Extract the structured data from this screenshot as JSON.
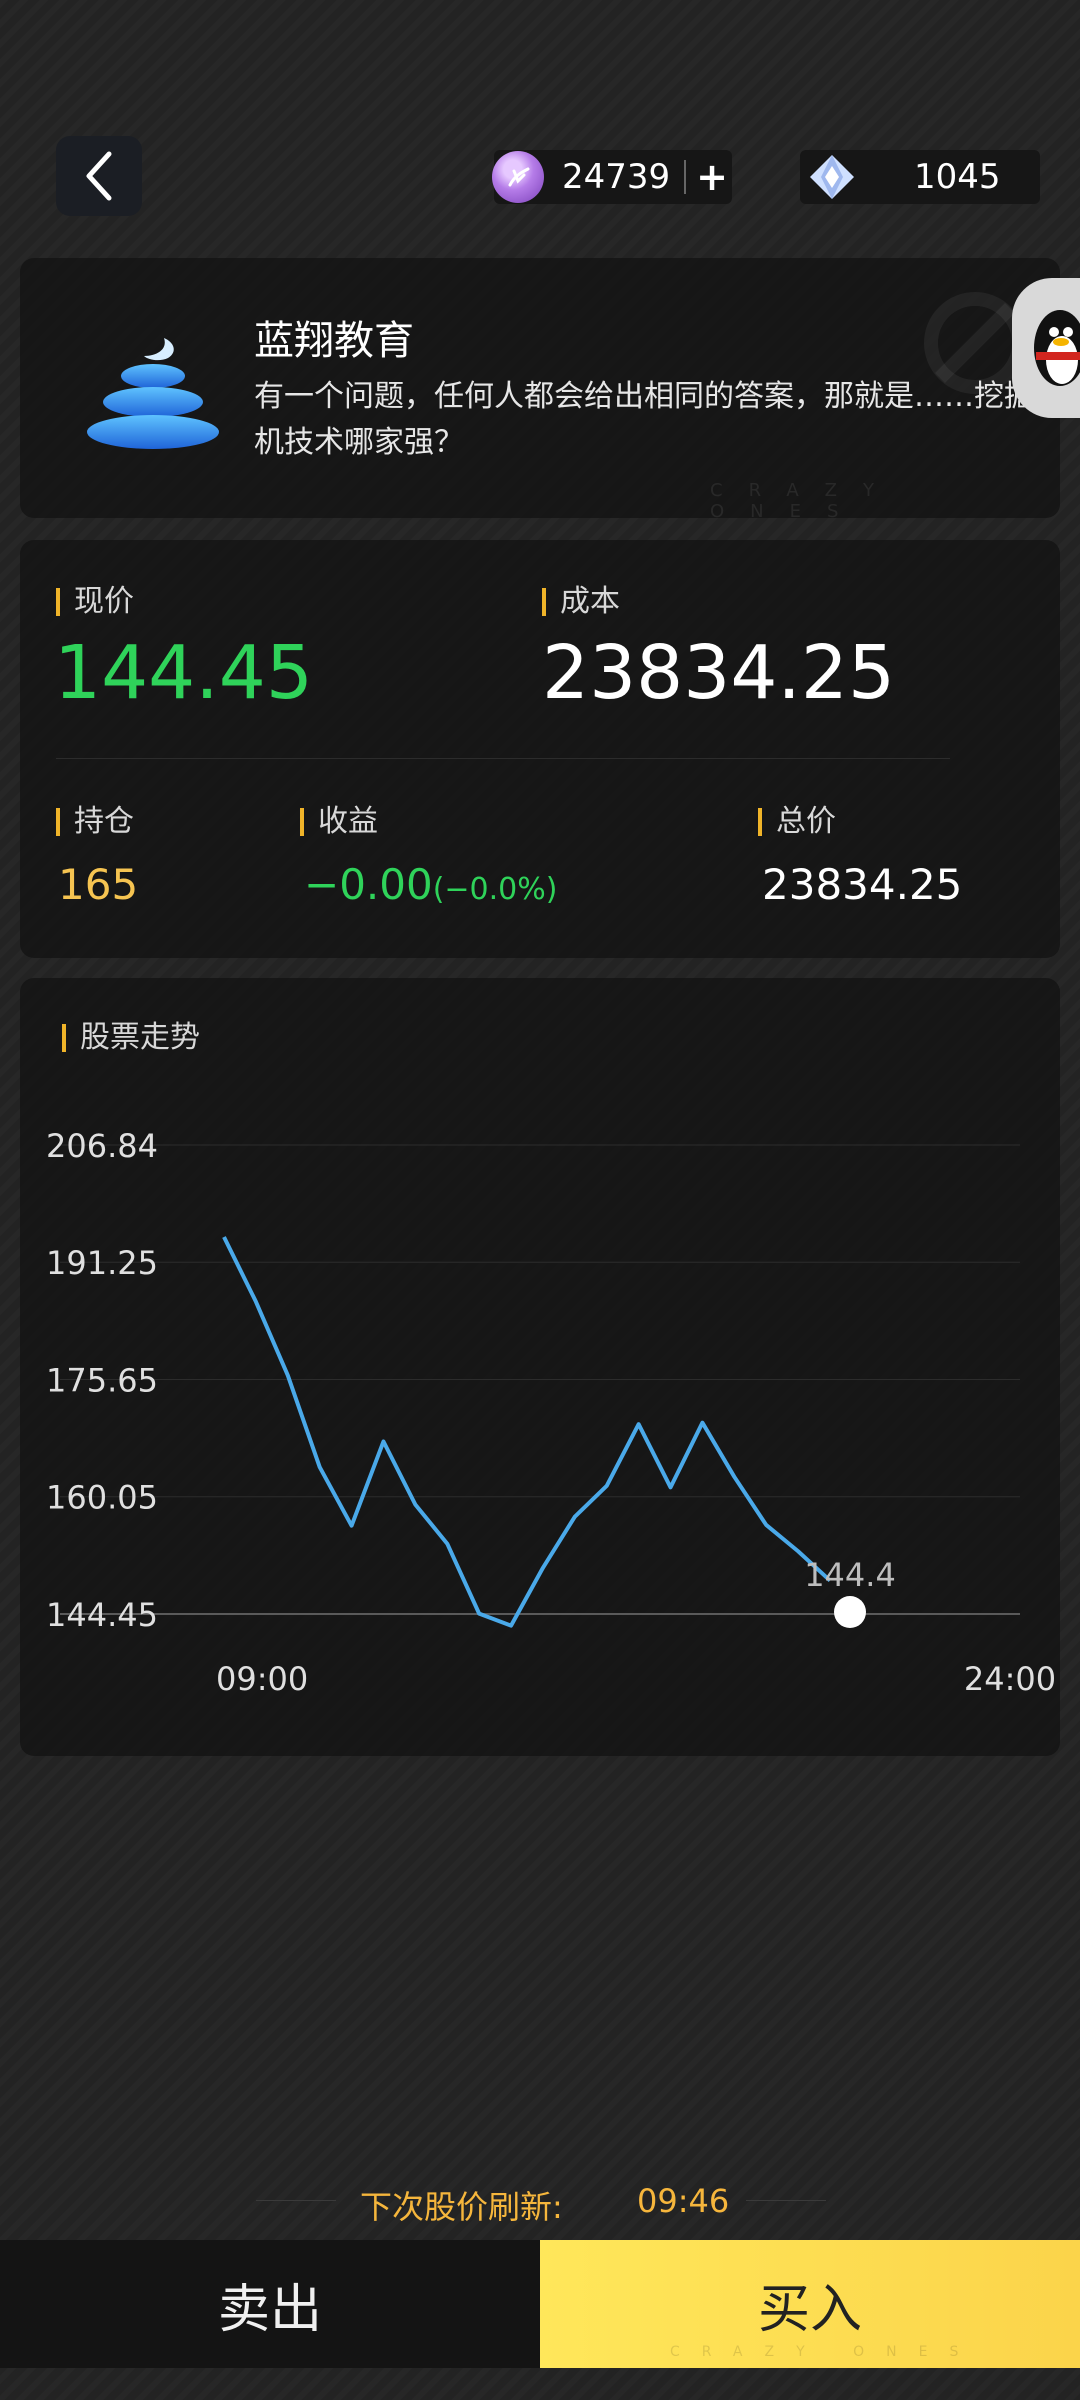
{
  "header": {
    "back_icon": "chevron-left-icon",
    "coins": "24739",
    "coins_plus": "+",
    "gems": "1045"
  },
  "company": {
    "name": "蓝翔教育",
    "description": "有一个问题，任何人都会给出相同的答案，那就是……挖掘机技术哪家强？",
    "watermark": "CRAZY ONES"
  },
  "quote": {
    "price_label": "现价",
    "price": "144.45",
    "cost_label": "成本",
    "cost": "23834.25",
    "holding_label": "持仓",
    "holding": "165",
    "profit_label": "收益",
    "profit": "−0.00",
    "profit_pct": "(−0.0%)",
    "total_label": "总价",
    "total": "23834.25"
  },
  "chart_section": {
    "title": "股票走势"
  },
  "chart_data": {
    "type": "line",
    "title": "股票走势",
    "y_ticks": [
      "206.84",
      "191.25",
      "175.65",
      "160.05",
      "144.45"
    ],
    "ylim": [
      144.45,
      206.84
    ],
    "x_ticks": [
      "09:00",
      "24:00"
    ],
    "series": [
      {
        "values": [
          194.6,
          186.0,
          176.2,
          164.0,
          156.2,
          167.4,
          159.0,
          153.8,
          144.5,
          142.9,
          150.6,
          157.4,
          161.5,
          169.7,
          161.3,
          169.9,
          162.7,
          156.3,
          152.8,
          148.9
        ]
      }
    ],
    "last_value_label": "144.4",
    "color": "#4aa9e9"
  },
  "refresh": {
    "label": "下次股价刷新:",
    "time": "09:46"
  },
  "actions": {
    "sell": "卖出",
    "buy": "买入"
  }
}
